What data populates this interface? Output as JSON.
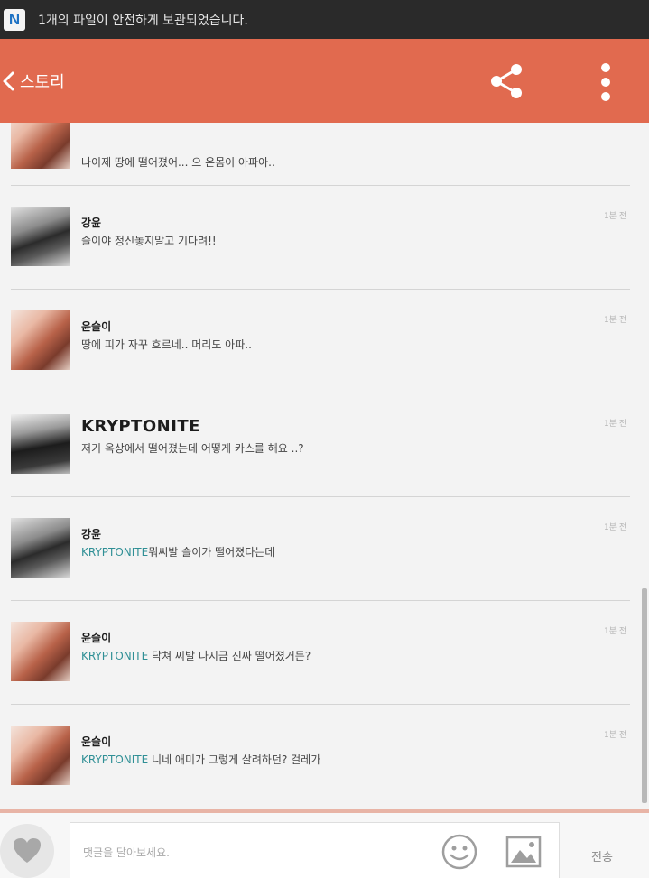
{
  "status_bar": {
    "notification": "1개의 파일이 안전하게 보관되었습니다."
  },
  "app_bar": {
    "title": "스토리"
  },
  "comments": [
    {
      "author": "",
      "text": "나이제 땅에 떨어졌어... 으 온몸이 아파아..",
      "time": ""
    },
    {
      "author": "강윤",
      "text": "슬이야 정신놓지말고 기다려!!",
      "time": "1분 전"
    },
    {
      "author": "윤슬이",
      "text": "땅에 피가 자꾸 흐르네.. 머리도 아파..",
      "time": "1분 전"
    },
    {
      "author": "KRYPTONITE",
      "text": "저기 옥상에서 떨어졌는데 어떻게 카스를 해요 ..?",
      "time": "1분 전"
    },
    {
      "author": "강윤",
      "mention": "KRYPTONITE",
      "text": "뭐씨발 슬이가 떨어졌다는데",
      "time": "1분 전"
    },
    {
      "author": "윤슬이",
      "mention": "KRYPTONITE",
      "text": " 닥쳐 씨발 나지금 진짜 떨어졌거든?",
      "time": "1분 전"
    },
    {
      "author": "윤슬이",
      "mention": "KRYPTONITE",
      "text": " 니네 애미가 그렇게 살려하던? 걸레가",
      "time": "1분 전"
    }
  ],
  "input": {
    "placeholder": "댓글을 달아보세요.",
    "send_label": "전송"
  },
  "colors": {
    "app_bar": "#e16a4f",
    "mention": "#2f8f95",
    "status_bar": "#2a2a2a"
  },
  "icons": [
    "back-chevron-icon",
    "share-icon",
    "more-vert-icon",
    "heart-icon",
    "emoji-icon",
    "image-icon"
  ]
}
